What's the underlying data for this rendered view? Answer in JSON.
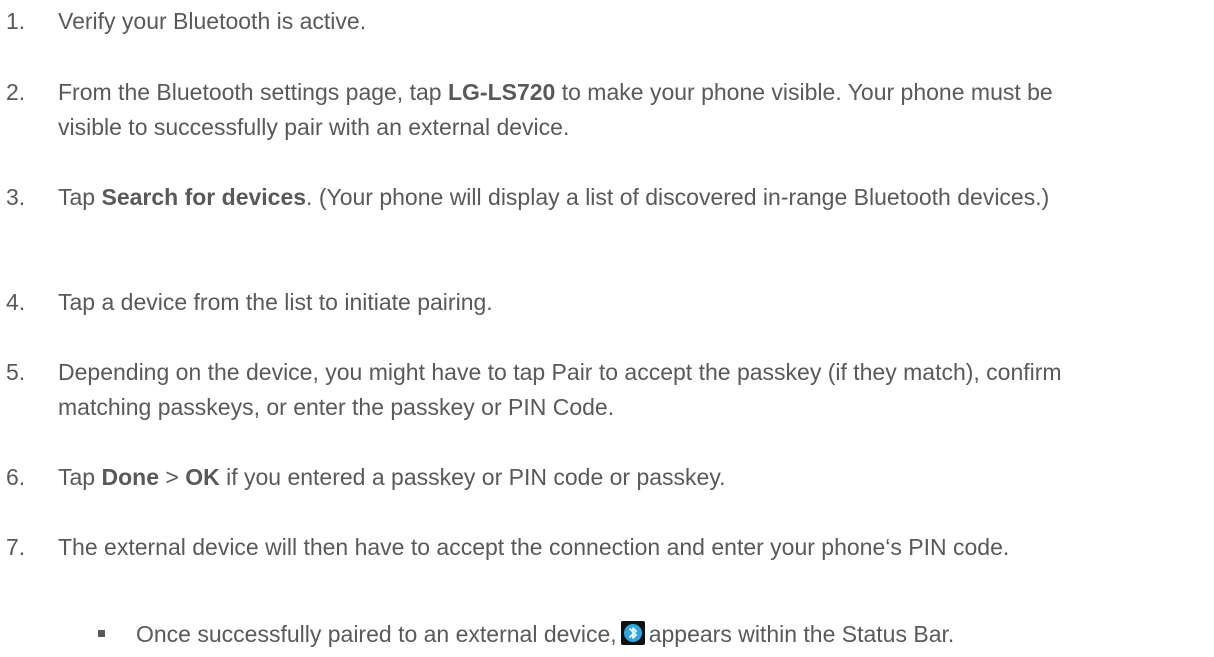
{
  "steps": [
    {
      "number": "1.",
      "parts": [
        {
          "t": "Verify your Bluetooth is active.",
          "b": false
        }
      ]
    },
    {
      "number": "2.",
      "parts": [
        {
          "t": "From the Bluetooth settings page, tap ",
          "b": false
        },
        {
          "t": "LG-LS720",
          "b": true
        },
        {
          "t": " to make your phone visible. Your phone must be visible to successfully pair with an external device.",
          "b": false
        }
      ]
    },
    {
      "number": "3.",
      "parts": [
        {
          "t": "Tap ",
          "b": false
        },
        {
          "t": "Search for devices",
          "b": true
        },
        {
          "t": ". (Your phone will display a list of discovered in-range Bluetooth devices.)",
          "b": false
        }
      ]
    },
    {
      "number": "4.",
      "parts": [
        {
          "t": "Tap a device from the list to initiate pairing.",
          "b": false
        }
      ]
    },
    {
      "number": "5.",
      "parts": [
        {
          "t": "Depending on the device, you might have to tap Pair to accept the passkey (if they match), confirm matching passkeys, or enter the passkey or PIN Code.",
          "b": false
        }
      ]
    },
    {
      "number": "6.",
      "parts": [
        {
          "t": "Tap ",
          "b": false
        },
        {
          "t": "Done",
          "b": true
        },
        {
          "t": " > ",
          "b": false
        },
        {
          "t": "OK",
          "b": true
        },
        {
          "t": " if you entered a passkey or PIN code or passkey.",
          "b": false
        }
      ]
    },
    {
      "number": "7.",
      "parts": [
        {
          "t": "The external device will then have to accept the connection and enter your phone‘s PIN code.",
          "b": false
        }
      ]
    }
  ],
  "bullet": {
    "before": "Once successfully paired to an external device,",
    "icon": "bluetooth-connected-icon",
    "after": "appears within the Status Bar."
  }
}
